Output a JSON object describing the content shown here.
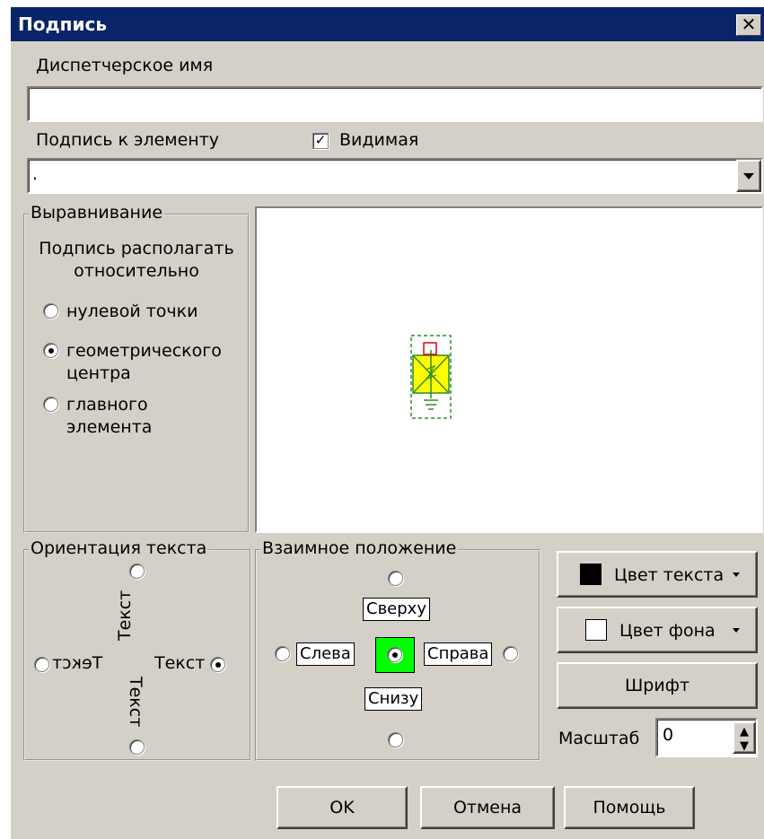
{
  "window": {
    "title": "Подпись",
    "close_glyph": "✕"
  },
  "dispatcher_name": {
    "label": "Диспетчерское имя",
    "value": ""
  },
  "element_caption": {
    "label": "Подпись к элементу",
    "visible_label": "Видимая",
    "visible_checked": true,
    "combo_value": "."
  },
  "alignment": {
    "group_title": "Выравнивание",
    "caption_line1": "Подпись располагать",
    "caption_line2": "относительно",
    "options": [
      {
        "label_line1": "нулевой точки",
        "label_line2": "",
        "selected": false
      },
      {
        "label_line1": "геометрического",
        "label_line2": "центра",
        "selected": true
      },
      {
        "label_line1": "главного",
        "label_line2": "элемента",
        "selected": false
      }
    ]
  },
  "orientation": {
    "group_title": "Ориентация текста",
    "text_up": "Текст",
    "text_down": "Текст",
    "text_left": "Текст",
    "text_right": "Текст",
    "selected": "right"
  },
  "position": {
    "group_title": "Взаимное положение",
    "top": "Сверху",
    "left": "Слева",
    "right": "Справа",
    "bottom": "Снизу",
    "selected": "center",
    "center_color": "#00ff00"
  },
  "buttons": {
    "text_color": "Цвет текста",
    "bg_color": "Цвет фона",
    "font": "Шрифт",
    "ok": "OK",
    "cancel": "Отмена",
    "help": "Помощь"
  },
  "scale": {
    "label": "Масштаб",
    "value": "0"
  },
  "colors": {
    "text_swatch": "#000000",
    "bg_swatch": "#ffffff",
    "titlebar": "#0a246a"
  }
}
